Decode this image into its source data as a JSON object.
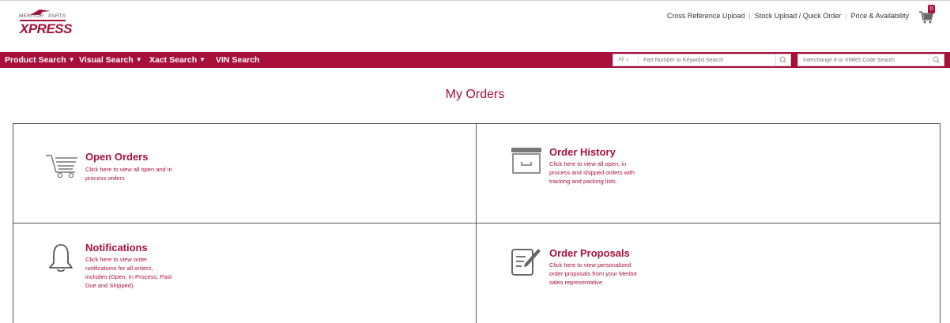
{
  "brand": {
    "top_left": "MERITOR",
    "top_right": "PARTS",
    "wordmark": "XPRESS",
    "color": "#a8103b"
  },
  "utility_links": [
    "Cross Reference Upload",
    "Stock Upload / Quick Order",
    "Price & Availability"
  ],
  "cart": {
    "count": "0"
  },
  "nav": [
    {
      "label": "Product Search",
      "has_dropdown": true
    },
    {
      "label": "Visual Search",
      "has_dropdown": true
    },
    {
      "label": "Xact Search",
      "has_dropdown": true
    },
    {
      "label": "VIN Search",
      "has_dropdown": false
    }
  ],
  "search": {
    "scope": "All",
    "placeholder": "Part Number or Keyword Search",
    "interchange_placeholder": "Interchange # or VMRS Code Search"
  },
  "page_title": "My Orders",
  "cards": [
    {
      "title": "Open Orders",
      "desc": [
        "Click here to view all open and in",
        "process orders"
      ],
      "icon": "cart-icon"
    },
    {
      "title": "Order History",
      "desc": [
        "Click here to view all open, in",
        "process and shipped orders with",
        "tracking and packing lists."
      ],
      "icon": "archive-box-icon"
    },
    {
      "title": "Notifications",
      "desc": [
        "Click here to view order",
        "notifications for all orders,",
        "includes (Open, In Process, Past",
        "Due and Shipped)."
      ],
      "icon": "bell-icon"
    },
    {
      "title": "Order Proposals",
      "desc": [
        "Click here to view personalized",
        "order proposals from your Meritor",
        "sales representative"
      ],
      "icon": "edit-document-icon"
    }
  ]
}
